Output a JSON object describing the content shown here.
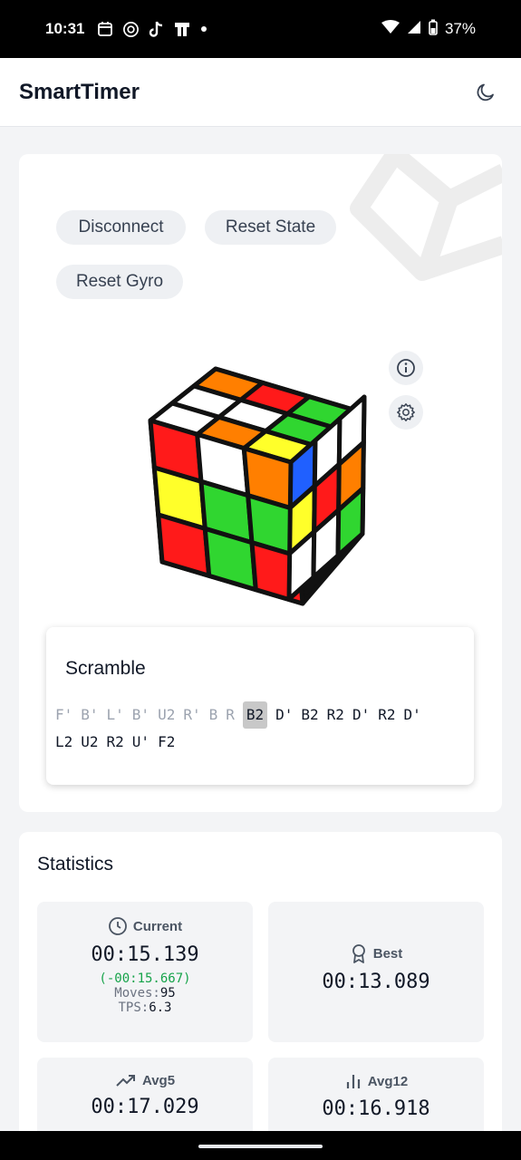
{
  "status_bar": {
    "time": "10:31",
    "left_icons": [
      "calendar-icon",
      "at-icon",
      "tiktok-icon",
      "app-icon",
      "dot-icon"
    ],
    "battery": "37%"
  },
  "app_bar": {
    "title": "SmartTimer",
    "theme_icon": "moon-icon"
  },
  "controls": {
    "disconnect": "Disconnect",
    "reset_state": "Reset State",
    "reset_gyro": "Reset Gyro"
  },
  "cube": {
    "top": [
      [
        "#ff7f00",
        "#ff1a1a",
        "#30d630"
      ],
      [
        "#ffffff",
        "#ffffff",
        "#30d630"
      ],
      [
        "#ffffff",
        "#ff7f00",
        "#ffff2a"
      ]
    ],
    "front": [
      [
        "#ff1a1a",
        "#ffffff",
        "#ff7f00"
      ],
      [
        "#ffff2a",
        "#30d630",
        "#30d630"
      ],
      [
        "#ff1a1a",
        "#30d630",
        "#ff1a1a"
      ]
    ],
    "right": [
      [
        "#2060ff",
        "#ffffff",
        "#ffffff"
      ],
      [
        "#ffff2a",
        "#ff1a1a",
        "#ff7f00"
      ],
      [
        "#ffffff",
        "#ffffff",
        "#30d630"
      ]
    ]
  },
  "scramble": {
    "heading": "Scramble",
    "moves": [
      {
        "m": "F'",
        "s": "done"
      },
      {
        "m": "B'",
        "s": "done"
      },
      {
        "m": "L'",
        "s": "done"
      },
      {
        "m": "B'",
        "s": "done"
      },
      {
        "m": "U2",
        "s": "done"
      },
      {
        "m": "R'",
        "s": "done"
      },
      {
        "m": "B",
        "s": "done"
      },
      {
        "m": "R",
        "s": "done"
      },
      {
        "m": "B2",
        "s": "current"
      },
      {
        "m": "D'",
        "s": "next"
      },
      {
        "m": "B2",
        "s": "next"
      },
      {
        "m": "R2",
        "s": "next"
      },
      {
        "m": "D'",
        "s": "next"
      },
      {
        "m": "R2",
        "s": "next"
      },
      {
        "m": "D'",
        "s": "next"
      },
      {
        "m": "L2",
        "s": "next"
      },
      {
        "m": "U2",
        "s": "next"
      },
      {
        "m": "R2",
        "s": "next"
      },
      {
        "m": "U'",
        "s": "next"
      },
      {
        "m": "F2",
        "s": "next"
      }
    ]
  },
  "statistics": {
    "title": "Statistics",
    "current": {
      "label": "Current",
      "value": "00:15.139",
      "diff": "(-00:15.667)",
      "moves_label": "Moves:",
      "moves": "95",
      "tps_label": "TPS:",
      "tps": "6.3"
    },
    "best": {
      "label": "Best",
      "value": "00:13.089"
    },
    "avg5": {
      "label": "Avg5",
      "value": "00:17.029"
    },
    "avg12": {
      "label": "Avg12",
      "value": "00:16.918"
    }
  }
}
